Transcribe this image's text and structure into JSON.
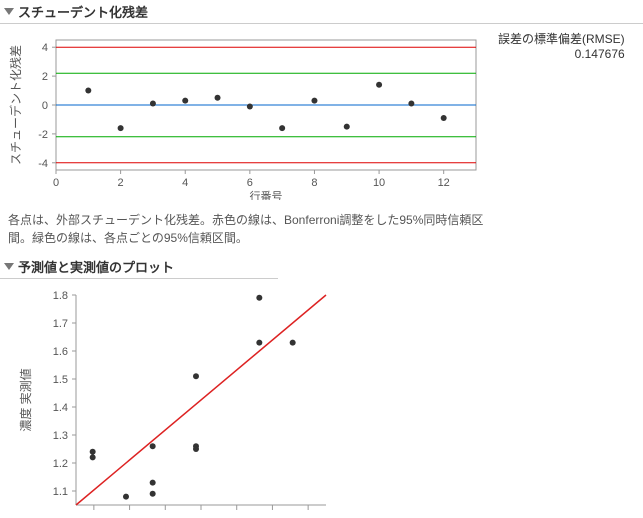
{
  "section1": {
    "title": "スチューデント化残差"
  },
  "stats": {
    "rmse_label": "誤差の標準偏差(RMSE)",
    "rmse_value": "0.147676"
  },
  "caption": "各点は、外部スチューデント化残差。赤色の線は、Bonferroni調整をした95%同時信頼区間。緑色の線は、各点ごとの95%信頼区間。",
  "section2": {
    "title": "予測値と実測値のプロット"
  },
  "chart1": {
    "ylabel": "スチューデント化残差",
    "xlabel": "行番号",
    "xticks": [
      "0",
      "2",
      "4",
      "6",
      "8",
      "10",
      "12"
    ],
    "yticks": [
      "-4",
      "-2",
      "0",
      "2",
      "4"
    ]
  },
  "chart2": {
    "ylabel": "濃度 実測値",
    "yticks": [
      "1.1",
      "1.2",
      "1.3",
      "1.4",
      "1.5",
      "1.6",
      "1.7",
      "1.8"
    ]
  },
  "chart_data": [
    {
      "type": "scatter",
      "title": "スチューデント化残差",
      "xlabel": "行番号",
      "ylabel": "スチューデント化残差",
      "xlim": [
        0,
        13
      ],
      "ylim": [
        -4.5,
        4.5
      ],
      "reference_lines": {
        "red": [
          4,
          -4
        ],
        "green": [
          2.2,
          -2.2
        ],
        "blue": [
          0
        ]
      },
      "x": [
        1,
        2,
        3,
        4,
        5,
        6,
        7,
        8,
        9,
        10,
        11,
        12
      ],
      "y": [
        1.0,
        -1.6,
        0.1,
        0.3,
        0.5,
        -0.1,
        -1.6,
        0.3,
        -1.5,
        1.4,
        0.1,
        -0.9
      ]
    },
    {
      "type": "scatter",
      "title": "予測値と実測値のプロット",
      "ylabel": "濃度 実測値",
      "xlim": [
        1.05,
        1.8
      ],
      "ylim": [
        1.05,
        1.8
      ],
      "identity_line": true,
      "points": [
        [
          1.1,
          1.24
        ],
        [
          1.1,
          1.22
        ],
        [
          1.2,
          1.08
        ],
        [
          1.28,
          1.26
        ],
        [
          1.28,
          1.13
        ],
        [
          1.28,
          1.09
        ],
        [
          1.41,
          1.51
        ],
        [
          1.41,
          1.26
        ],
        [
          1.41,
          1.25
        ],
        [
          1.6,
          1.79
        ],
        [
          1.6,
          1.63
        ],
        [
          1.7,
          1.63
        ]
      ]
    }
  ]
}
